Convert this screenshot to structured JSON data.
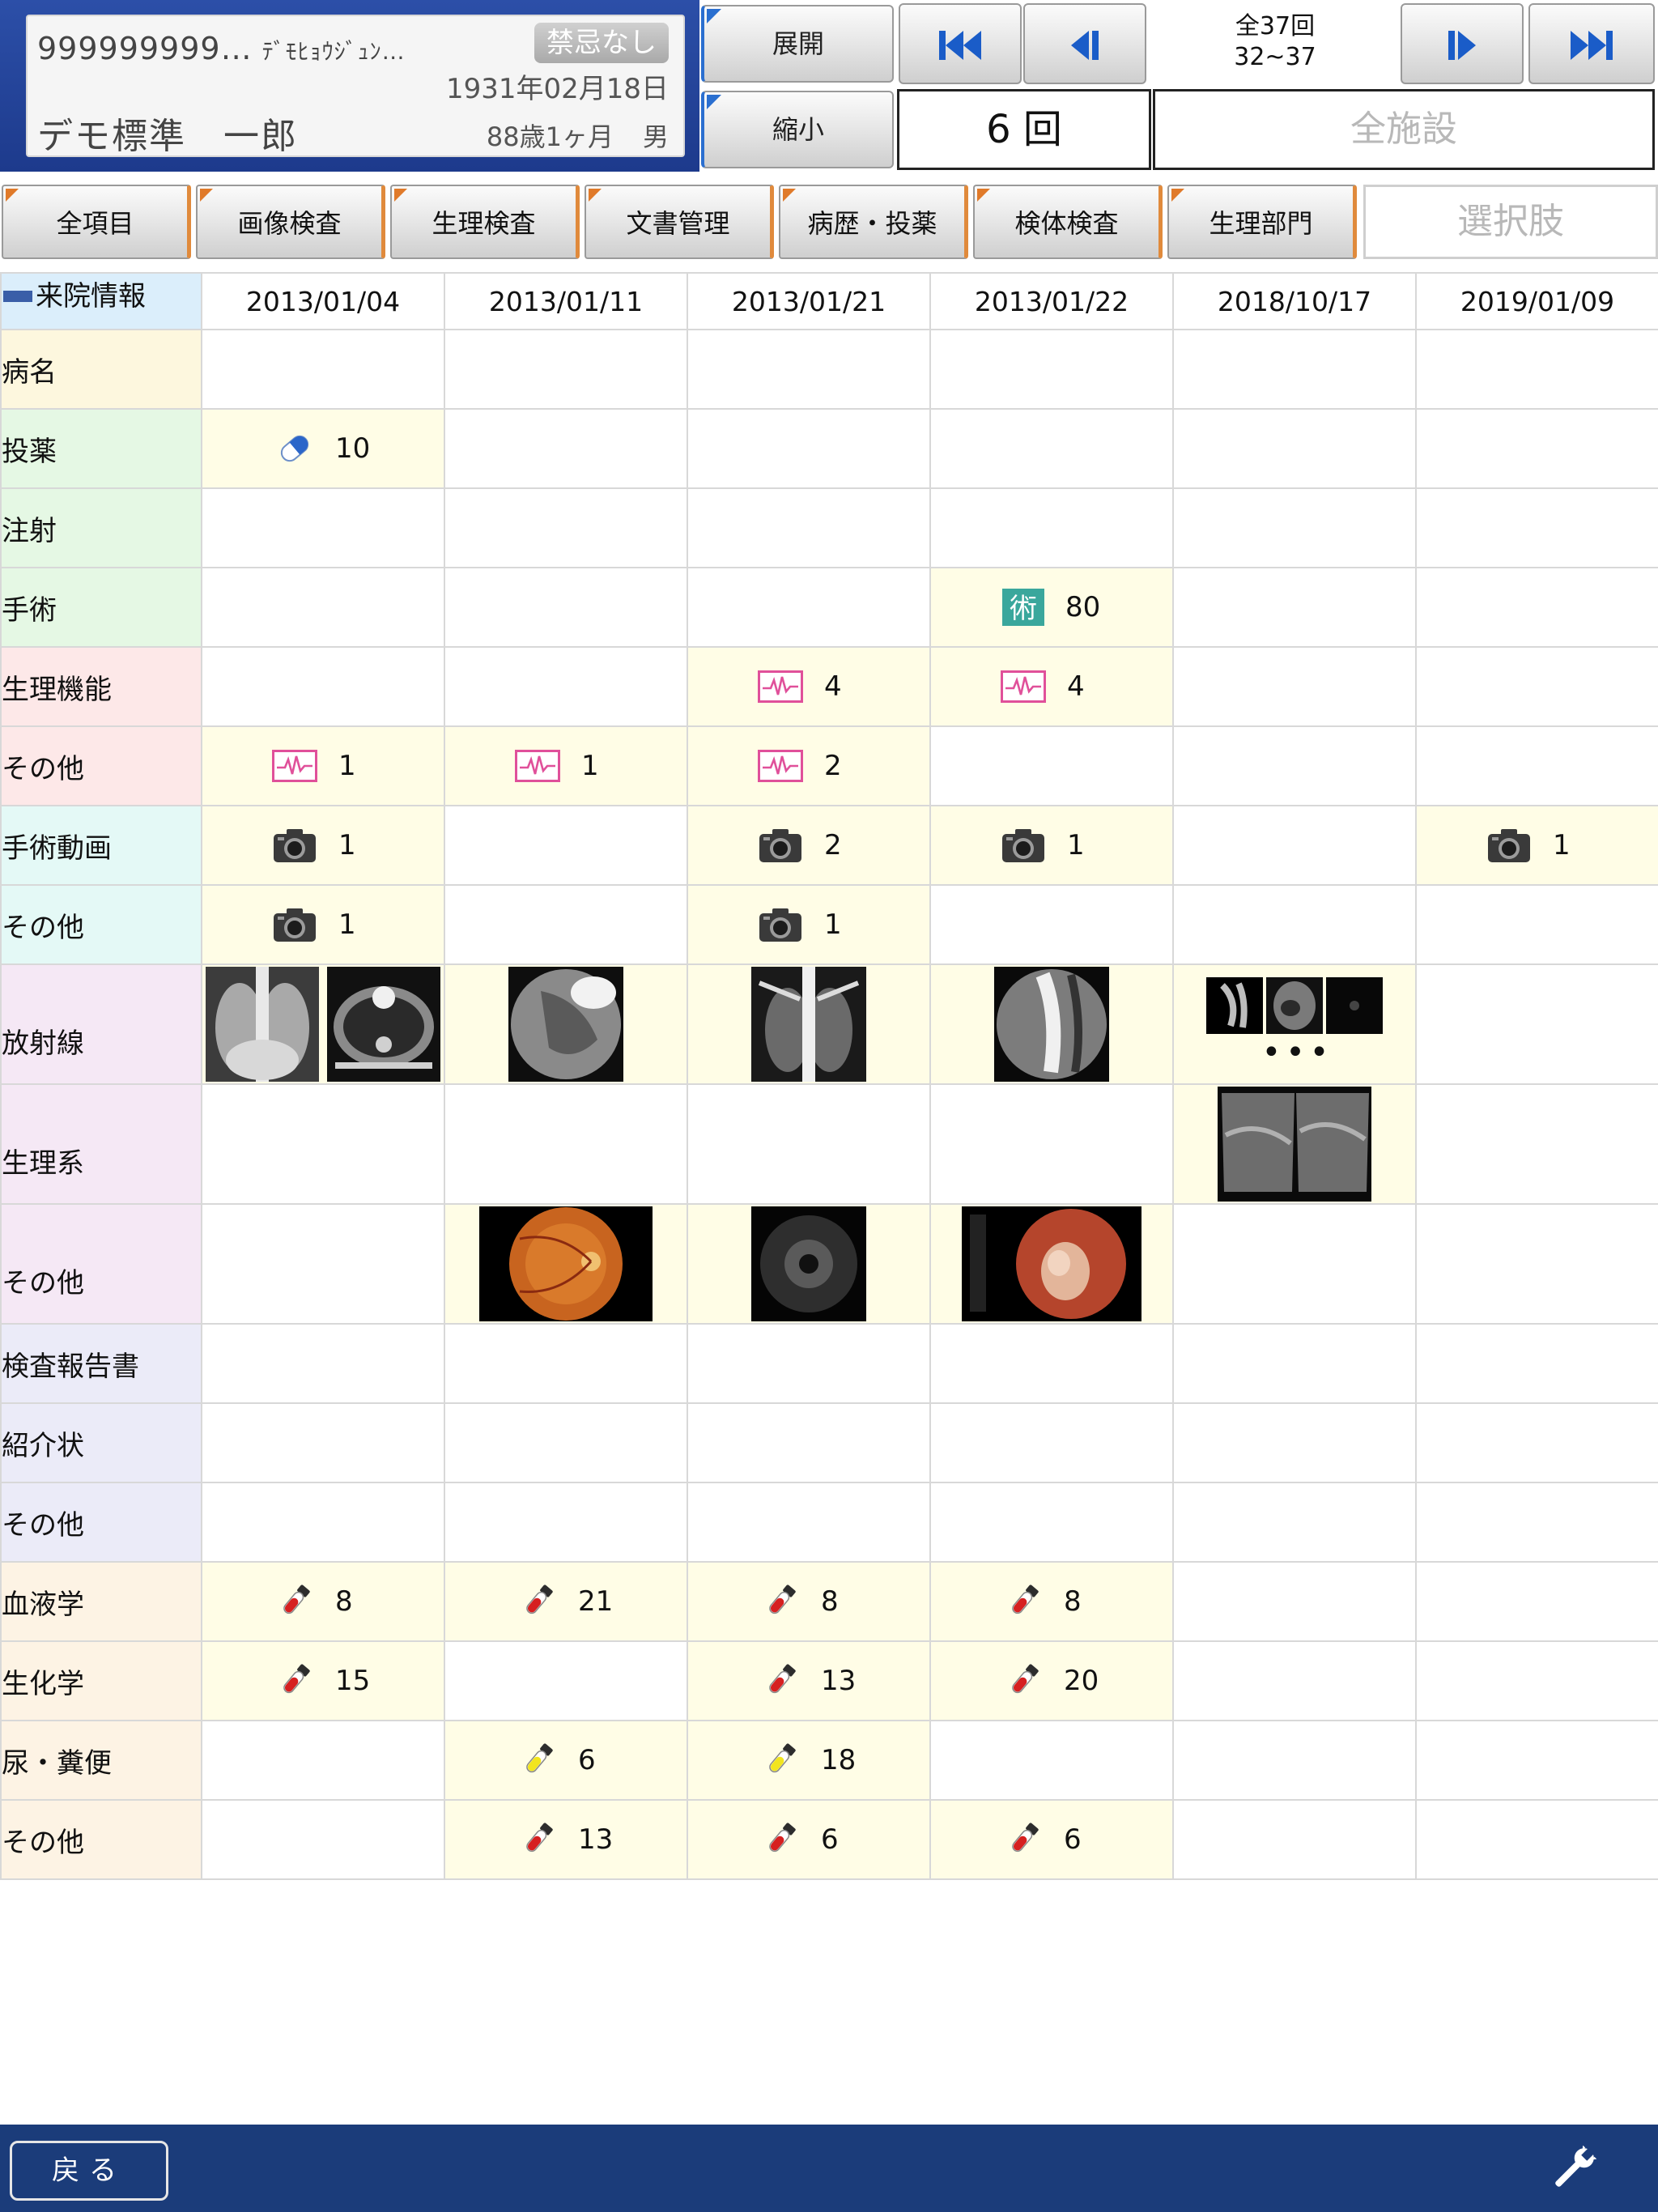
{
  "patient": {
    "id": "999999999…",
    "kana": "ﾃﾞﾓﾋｮｳｼﾞｭﾝ…",
    "allergy": "禁忌なし",
    "birth": "1931年02月18日",
    "name": "デモ標準　一郎",
    "age": "88歳1ヶ月",
    "sex": "男"
  },
  "controls": {
    "expand": "展開",
    "shrink": "縮小",
    "total": "全37回",
    "range": "32~37",
    "visit_count": "6 回",
    "facility": "全施設"
  },
  "tabs": [
    "全項目",
    "画像検査",
    "生理検査",
    "文書管理",
    "病歴・投薬",
    "検体検査",
    "生理部門"
  ],
  "select_placeholder": "選択肢",
  "header": {
    "title": "来院情報"
  },
  "dates": [
    "2013/01/04",
    "2013/01/11",
    "2013/01/21",
    "2013/01/22",
    "2018/10/17",
    "2019/01/09"
  ],
  "rows": {
    "byomei": {
      "label": "病名"
    },
    "toyaku": {
      "label": "投薬",
      "c0": "10"
    },
    "chusha": {
      "label": "注射"
    },
    "shujutsu": {
      "label": "手術",
      "c3": "80"
    },
    "seiri_kino": {
      "label": "生理機能",
      "c2": "4",
      "c3": "4"
    },
    "sonota1": {
      "label": "その他",
      "c0": "1",
      "c1": "1",
      "c2": "2"
    },
    "shujutsu_doga": {
      "label": "手術動画",
      "c0": "1",
      "c2": "2",
      "c3": "1",
      "c5": "1"
    },
    "sonota2": {
      "label": "その他",
      "c0": "1",
      "c2": "1"
    },
    "hoshasen": {
      "label": "放射線"
    },
    "seirikei": {
      "label": "生理系"
    },
    "sonota3": {
      "label": "その他"
    },
    "kensa_hokoku": {
      "label": "検査報告書"
    },
    "shokaijo": {
      "label": "紹介状"
    },
    "sonota4": {
      "label": "その他"
    },
    "ketsueki": {
      "label": "血液学",
      "c0": "8",
      "c1": "21",
      "c2": "8",
      "c3": "8"
    },
    "seikagaku": {
      "label": "生化学",
      "c0": "15",
      "c2": "13",
      "c3": "20"
    },
    "nyo": {
      "label": "尿・糞便",
      "c1": "6",
      "c2": "18"
    },
    "sonota5": {
      "label": "その他",
      "c1": "13",
      "c2": "6",
      "c3": "6"
    }
  },
  "footer": {
    "back": "戻る"
  },
  "icons": {
    "pill": "capsule-icon",
    "surgery": "surgery-kanji-icon",
    "ecg": "ecg-waveform-icon",
    "camera": "camera-icon",
    "tube_red": "blood-tube-icon",
    "tube_yellow": "urine-tube-icon",
    "wrench": "wrench-icon"
  },
  "colors": {
    "header_blue": "#1d3a8c",
    "highlight_cell": "#fffde6",
    "tab_accent": "#e07a2a",
    "button_accent": "#2a6fd0",
    "footer": "#1b3c7a"
  }
}
